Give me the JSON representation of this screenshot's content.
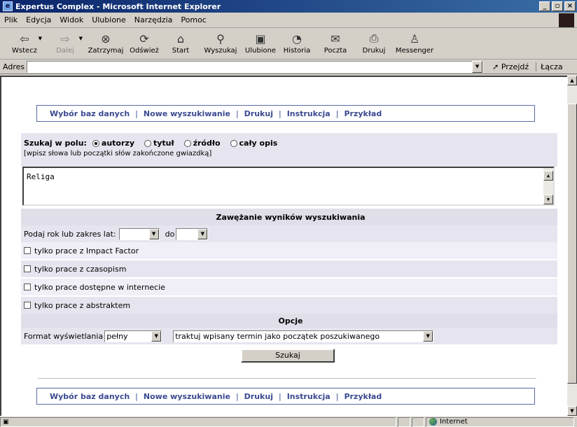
{
  "window": {
    "title": "Expertus Complex - Microsoft Internet Explorer"
  },
  "menu": [
    "Plik",
    "Edycja",
    "Widok",
    "Ulubione",
    "Narzędzia",
    "Pomoc"
  ],
  "toolbar": {
    "back": "Wstecz",
    "forward": "Dalej",
    "stop": "Zatrzymaj",
    "refresh": "Odśwież",
    "home": "Start",
    "search": "Wyszukaj",
    "favorites": "Ulubione",
    "history": "Historia",
    "mail": "Poczta",
    "print": "Drukuj",
    "messenger": "Messenger"
  },
  "address": {
    "label": "Adres",
    "value": "",
    "go": "Przejdź",
    "links": "Łącza"
  },
  "nav": {
    "databases": "Wybór baz danych",
    "new_search": "Nowe wyszukiwanie",
    "print": "Drukuj",
    "instructions": "Instrukcja",
    "example": "Przykład",
    "separator": "|"
  },
  "search": {
    "label": "Szukaj w polu:",
    "fields": [
      "autorzy",
      "tytuł",
      "źródło",
      "cały opis"
    ],
    "selected_field": "autorzy",
    "hint": "[wpisz słowa lub początki słów zakończone gwiazdką]",
    "query": "Religa"
  },
  "filters": {
    "heading": "Zawężanie wyników wyszukiwania",
    "year_label": "Podaj rok lub zakres lat:",
    "year_from": "",
    "to_label": "do",
    "year_to": "",
    "impact_factor": "tylko prace z Impact Factor",
    "journals": "tylko prace z czasopism",
    "online": "tylko prace dostępne w internecie",
    "abstract": "tylko prace z abstraktem"
  },
  "options": {
    "heading": "Opcje",
    "format_label": "Format wyświetlania",
    "format_value": "pełny",
    "term_mode": "traktuj wpisany termin jako początek poszukiwanego"
  },
  "submit": "Szukaj",
  "status": {
    "zone": "Internet"
  }
}
